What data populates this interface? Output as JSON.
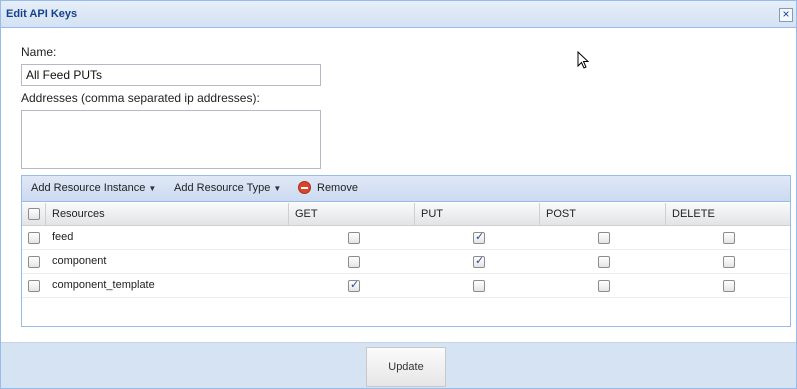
{
  "dialog": {
    "title": "Edit API Keys",
    "close_label": "×"
  },
  "form": {
    "name_label": "Name:",
    "name_value": "All Feed PUTs",
    "addresses_label": "Addresses (comma separated ip addresses):",
    "addresses_value": ""
  },
  "toolbar": {
    "add_instance_label": "Add Resource Instance",
    "add_type_label": "Add Resource Type",
    "remove_label": "Remove"
  },
  "grid": {
    "columns": [
      "Resources",
      "GET",
      "PUT",
      "POST",
      "DELETE"
    ],
    "rows": [
      {
        "resource": "feed",
        "get": false,
        "put": true,
        "post": false,
        "delete": false
      },
      {
        "resource": "component",
        "get": false,
        "put": true,
        "post": false,
        "delete": false
      },
      {
        "resource": "component_template",
        "get": true,
        "put": false,
        "post": false,
        "delete": false
      }
    ]
  },
  "footer": {
    "update_label": "Update"
  },
  "colors": {
    "title_text": "#15428b",
    "border": "#99bbe8",
    "footer_bg": "#d6e3f2",
    "remove_icon": "#d9442a"
  }
}
